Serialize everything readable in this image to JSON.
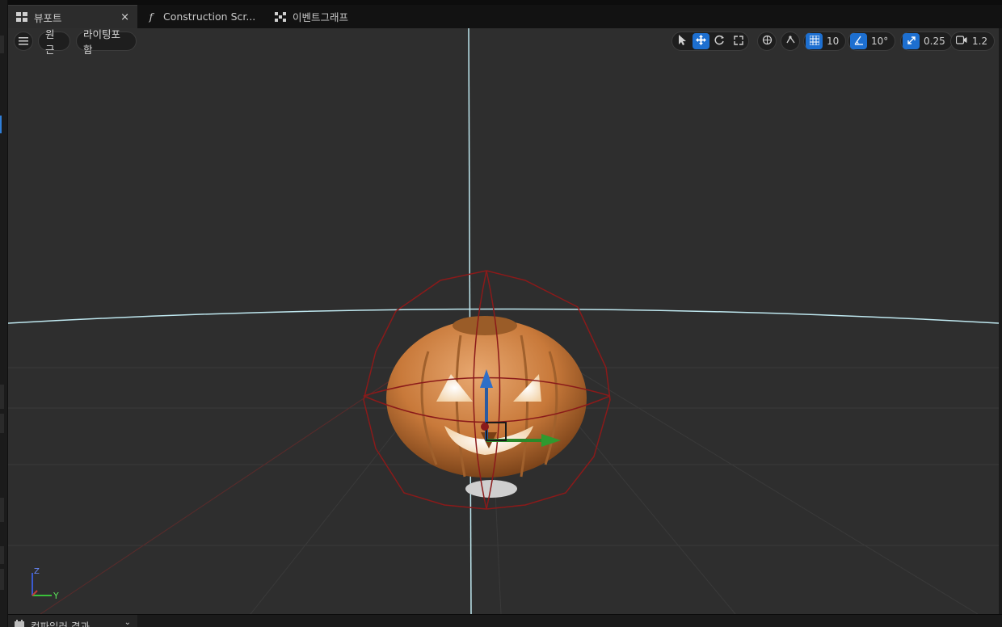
{
  "tabs": [
    {
      "label": "뷰포트",
      "icon": "viewport-grid-icon",
      "close": "×",
      "active": true
    },
    {
      "label": "Construction Scr...",
      "icon": "function-icon",
      "icon_glyph": "f",
      "active": false
    },
    {
      "label": "이벤트그래프",
      "icon": "graph-nodes-icon",
      "active": false
    }
  ],
  "viewport_controls": {
    "menu_icon": "hamburger-menu-icon",
    "perspective_label": "원근",
    "lighting_label": "라이팅포함"
  },
  "toolbar": {
    "transform_tools": [
      {
        "icon": "select-arrow-icon",
        "active": false
      },
      {
        "icon": "move-arrows-icon",
        "active": true
      },
      {
        "icon": "rotate-icon",
        "active": false
      },
      {
        "icon": "scale-icon",
        "active": false
      }
    ],
    "coordinate_icon": "world-coordinate-icon",
    "surface_snap_icon": "surface-snap-icon",
    "grid_snap_value": "10",
    "rotation_snap_value": "10°",
    "scale_snap_value": "0.25",
    "camera_speed_value": "1.2"
  },
  "axis_labels": {
    "z": "Z",
    "y": "Y"
  },
  "bottom_panel": {
    "label": "컴파일러 결과",
    "icon": "compiler-icon",
    "chevron": "⌄"
  },
  "colors": {
    "accent": "#1d6fd0",
    "viewport_bg": "#2e2e2e",
    "pumpkin": "#c8793a",
    "bounds_wire": "#8a1a1a",
    "horizon": "#bfe8f0"
  }
}
